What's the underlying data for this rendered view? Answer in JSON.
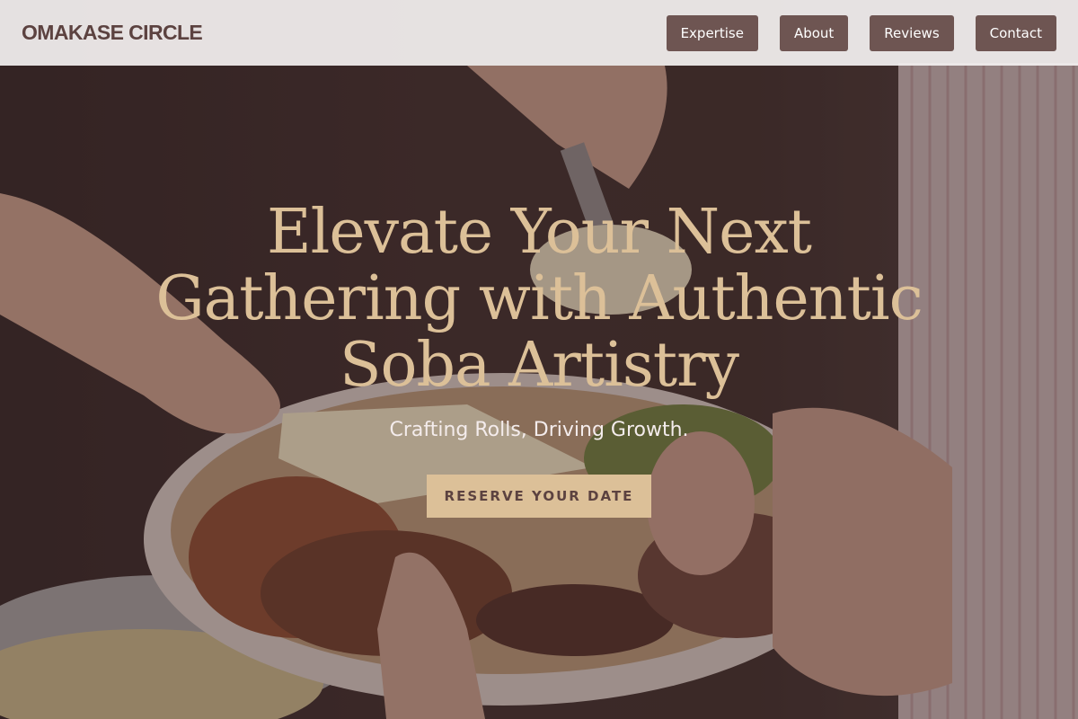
{
  "header": {
    "brand": "OMAKASE CIRCLE",
    "nav": [
      {
        "label": "Expertise"
      },
      {
        "label": "About"
      },
      {
        "label": "Reviews"
      },
      {
        "label": "Contact"
      }
    ]
  },
  "hero": {
    "headline": "Elevate Your Next Gathering with Authentic Soba Artistry",
    "tagline": "Crafting Rolls, Driving Growth.",
    "cta_label": "RESERVE YOUR DATE",
    "background_icon": "food-plate-photo"
  },
  "colors": {
    "nav_bg": "#f3f0f0",
    "brand": "#5c4240",
    "nav_button": "#6e5552",
    "accent_gold": "#dcc098",
    "overlay": "#3c2828"
  }
}
